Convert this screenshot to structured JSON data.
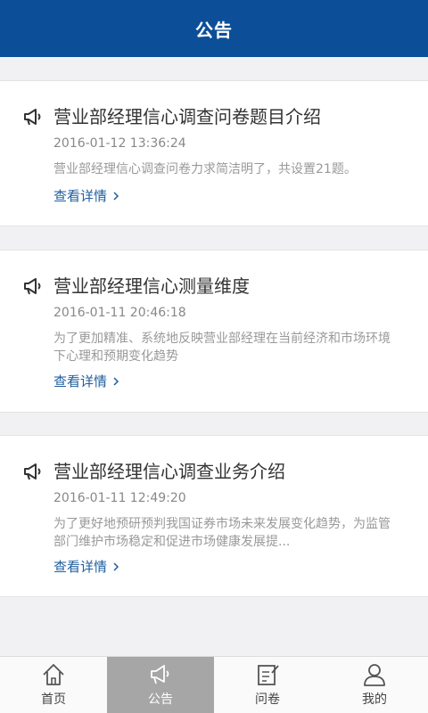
{
  "header": {
    "title": "公告"
  },
  "notices": [
    {
      "title": "营业部经理信心调查问卷题目介绍",
      "date": "2016-01-12 13:36:24",
      "summary": "营业部经理信心调查问卷力求简洁明了，共设置21题。",
      "link": "查看详情"
    },
    {
      "title": "营业部经理信心测量维度",
      "date": "2016-01-11 20:46:18",
      "summary": "为了更加精准、系统地反映营业部经理在当前经济和市场环境下心理和预期变化趋势",
      "link": "查看详情"
    },
    {
      "title": "营业部经理信心调查业务介绍",
      "date": "2016-01-11 12:49:20",
      "summary": "为了更好地预研预判我国证券市场未来发展变化趋势，为监管部门维护市场稳定和促进市场健康发展提...",
      "link": "查看详情"
    }
  ],
  "tabs": [
    {
      "label": "首页",
      "icon": "home-icon",
      "active": false
    },
    {
      "label": "公告",
      "icon": "megaphone-icon",
      "active": true
    },
    {
      "label": "问卷",
      "icon": "survey-icon",
      "active": false
    },
    {
      "label": "我的",
      "icon": "user-icon",
      "active": false
    }
  ],
  "colors": {
    "header": "#0c4f98",
    "link": "#1f5e9f",
    "active_tab": "#a6a6a6"
  }
}
